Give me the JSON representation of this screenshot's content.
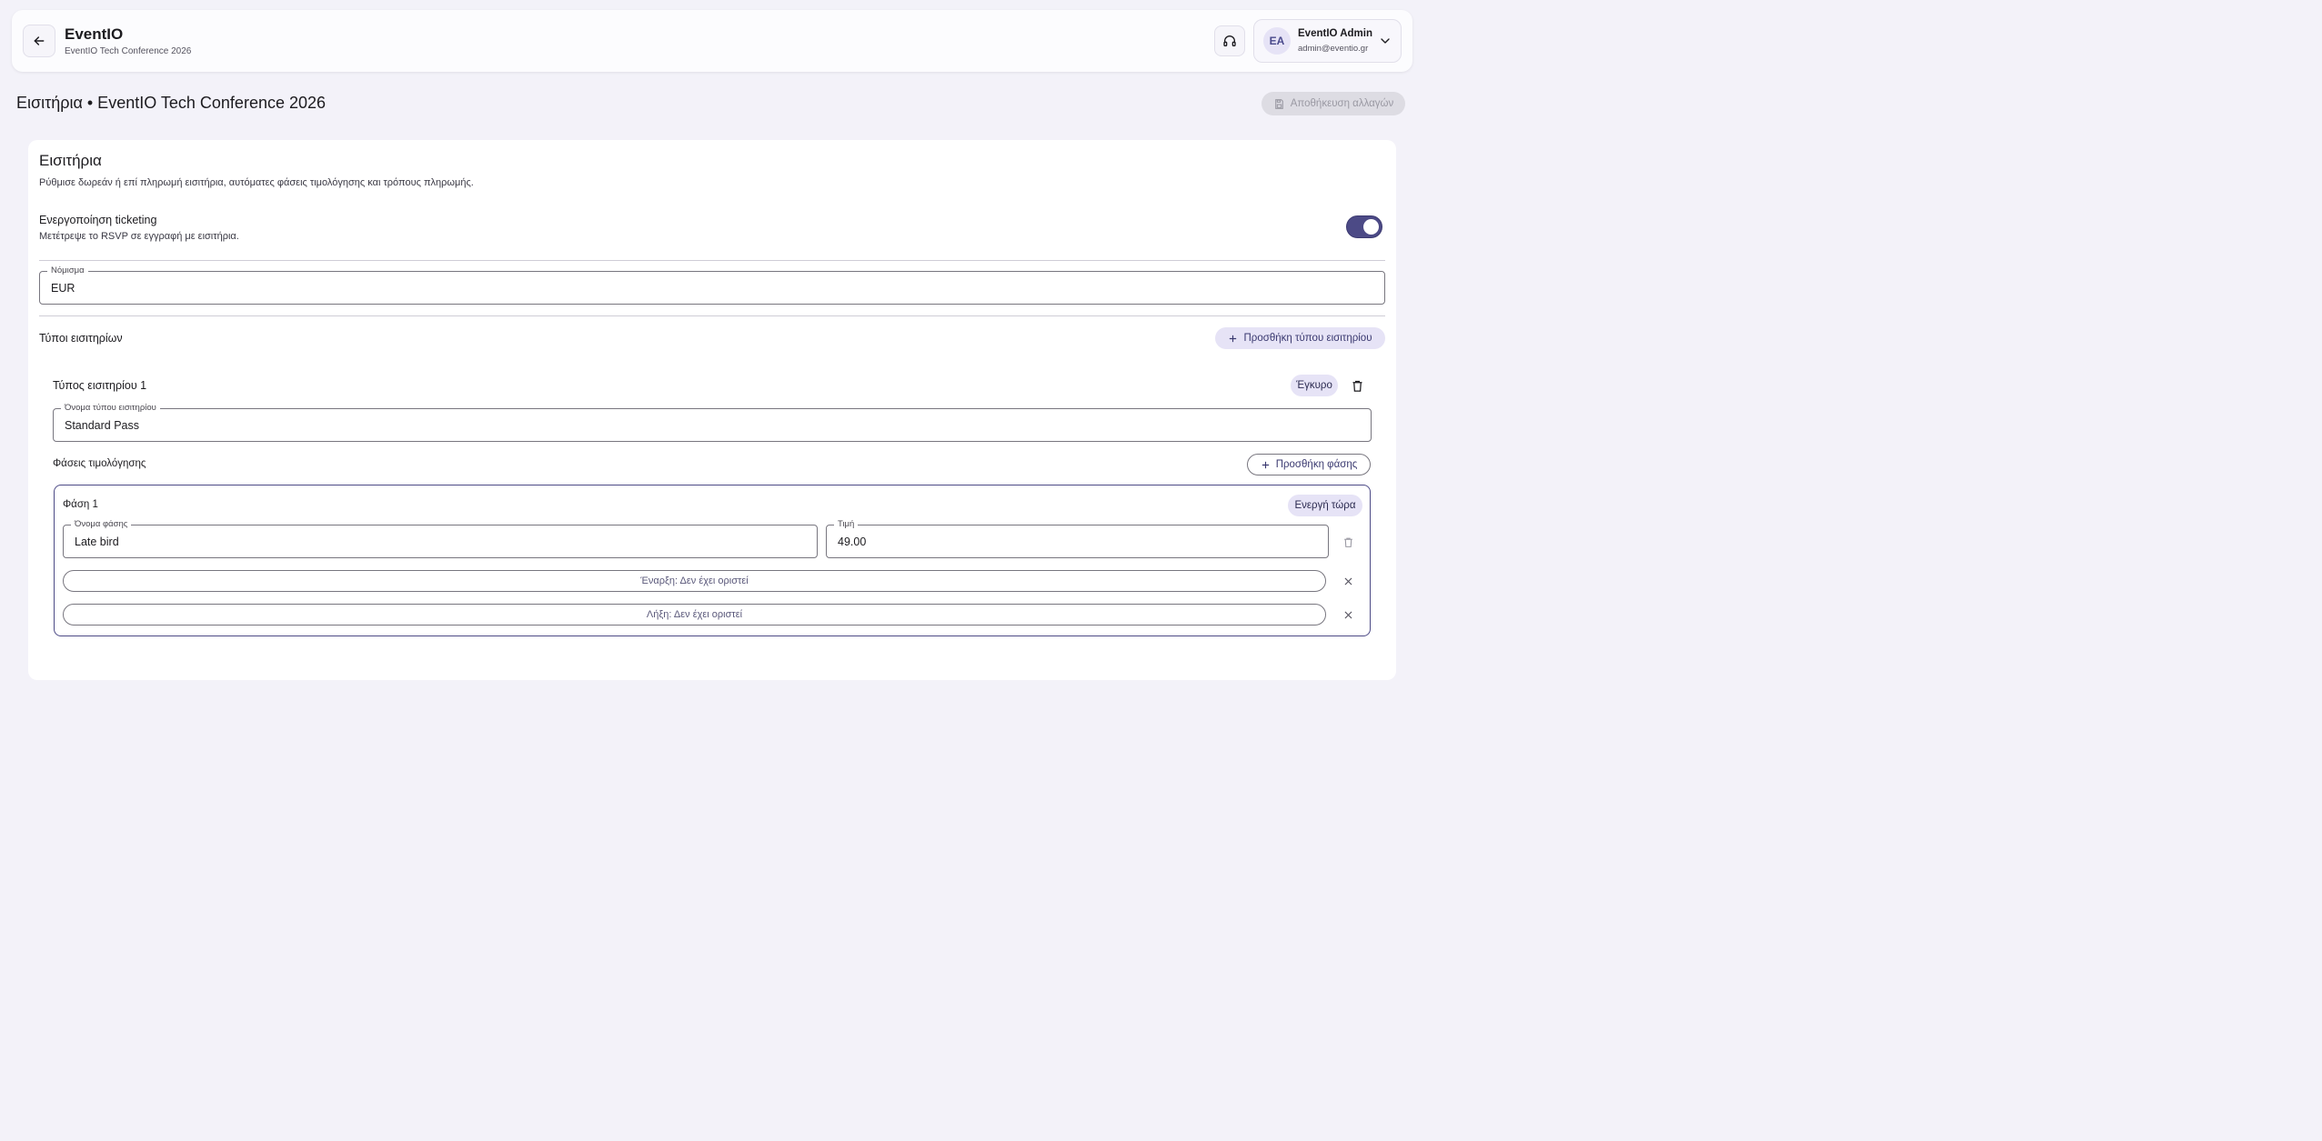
{
  "header": {
    "app_name": "EventIO",
    "event_subtitle": "EventIO Tech Conference 2026",
    "user": {
      "initials": "EA",
      "name": "EventIO Admin",
      "email": "admin@eventio.gr"
    }
  },
  "page": {
    "title": "Εισιτήρια • EventIO Tech Conference 2026",
    "save_label": "Αποθήκευση αλλαγών"
  },
  "card": {
    "title": "Εισιτήρια",
    "description": "Ρύθμισε δωρεάν ή επί πληρωμή εισιτήρια, αυτόματες φάσεις τιμολόγησης και τρόπους πληρωμής.",
    "ticketing_toggle": {
      "label": "Ενεργοποίηση ticketing",
      "description": "Μετέτρεψε το RSVP σε εγγραφή με εισιτήρια.",
      "enabled": true
    },
    "currency": {
      "label": "Νόμισμα",
      "value": "EUR"
    },
    "ticket_types_section": {
      "title": "Τύποι εισιτηρίων",
      "add_label": "Προσθήκη τύπου εισιτηρίου"
    },
    "ticket_type": {
      "title": "Τύπος εισιτηρίου 1",
      "status_badge": "Έγκυρο",
      "name_label": "Όνομα τύπου εισιτηρίου",
      "name_value": "Standard Pass",
      "phases_title": "Φάσεις τιμολόγησης",
      "add_phase_label": "Προσθήκη φάσης",
      "phase": {
        "title": "Φάση 1",
        "status_badge": "Ενεργή τώρα",
        "name_label": "Όνομα φάσης",
        "name_value": "Late bird",
        "price_label": "Τιμή",
        "price_value": "49.00",
        "start_label": "Έναρξη: Δεν έχει οριστεί",
        "end_label": "Λήξη: Δεν έχει οριστεί"
      }
    }
  },
  "colors": {
    "accent": "#4c4a86",
    "badge_bg": "#e6e3f6",
    "page_bg": "#f3f2f9"
  },
  "icons": [
    "arrow-left-icon",
    "headset-icon",
    "chevron-down-icon",
    "save-icon",
    "plus-icon",
    "trash-icon",
    "close-icon"
  ]
}
